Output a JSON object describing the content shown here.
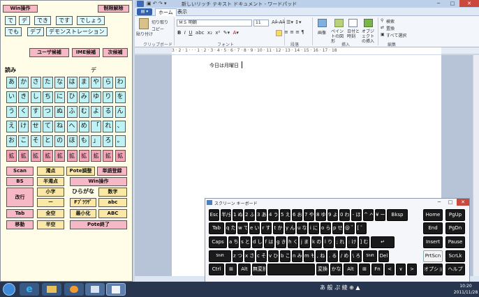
{
  "ime": {
    "top": {
      "win_label": "Win操作",
      "release_label": "制限解除"
    },
    "candidates": [
      [
        "で",
        "デ",
        "でき",
        "です",
        "でしょう"
      ],
      [
        "でも",
        "デブ",
        "デモンストレーション"
      ]
    ],
    "candidate_mode": {
      "user": "ユーザ候補",
      "ime": "IME候補",
      "next": "次候補"
    },
    "reading_label": "読み",
    "reading_value": "デ",
    "kana_rows": [
      [
        "あ",
        "か",
        "さ",
        "た",
        "な",
        "は",
        "ま",
        "や",
        "ら",
        "わ"
      ],
      [
        "い",
        "き",
        "し",
        "ち",
        "に",
        "ひ",
        "み",
        "ゆ",
        "り",
        "を"
      ],
      [
        "う",
        "く",
        "す",
        "つ",
        "ぬ",
        "ふ",
        "む",
        "よ",
        "る",
        "ん"
      ],
      [
        "え",
        "け",
        "せ",
        "て",
        "ね",
        "へ",
        "め",
        "「",
        "れ",
        "、"
      ],
      [
        "お",
        "こ",
        "そ",
        "と",
        "の",
        "ほ",
        "も",
        "」",
        "ろ",
        "。"
      ],
      [
        "拡",
        "拡",
        "拡",
        "拡",
        "拡",
        "拡",
        "拡",
        "拡",
        "拡",
        "拡"
      ]
    ],
    "controls": {
      "scan": "Scan",
      "dakuten": "濁点",
      "pote_adjust": "Pote調整",
      "register": "単語登録",
      "bs": "BS",
      "handakuten": "半濁点",
      "win_op": "Win操作",
      "kaigyo": "改行",
      "small": "小字",
      "hiragana": "ひらがな",
      "number": "数字",
      "dash": "ー",
      "fbrowser": "Fﾌﾞﾗｳｻﾞ",
      "abc_small": "abc",
      "tab": "Tab",
      "zenkaku": "全空",
      "minimize": "最小化",
      "abc_caps": "ABC",
      "move": "移動",
      "hankaku": "半空",
      "pote_end": "Pote終了"
    }
  },
  "wordpad": {
    "title": "新しいリッチ テキスト ドキュメント - ワードパッド",
    "tabs": [
      "ホーム",
      "表示"
    ],
    "ribbon": {
      "clipboard": {
        "paste": "貼り付け",
        "cut": "切り取り",
        "copy": "コピー",
        "label": "クリップボード"
      },
      "font": {
        "name": "ＭＳ 明朝",
        "size": "11",
        "label": "フォント"
      },
      "paragraph": {
        "label": "段落"
      },
      "insert": {
        "image": "画像",
        "paint": "ペイントの図形",
        "datetime": "日付と時刻",
        "object": "オブジェクトの挿入",
        "label": "挿入"
      },
      "edit": {
        "find": "検索",
        "replace": "置換",
        "select_all": "すべて選択",
        "label": "編集"
      }
    },
    "ruler": "3 · 2 · 1 · · · 1 · 2 · 3 · 4 · 5 · 6 · 7 · 8 · 9 · 10 · 11 · 12 · 13 · 14 · 15 · 16 · 17 · 18",
    "doc_text": "今日は月曜日"
  },
  "osk": {
    "title": "スクリーン キーボード",
    "rows": [
      [
        "Esc",
        "半/全",
        "1 ぬ",
        "2 ふ",
        "3 あ",
        "4 う",
        "5 え",
        "6 お",
        "7 や",
        "8 ゆ",
        "9 よ",
        "0 わ",
        "- ほ",
        "^ へ",
        "¥ ー",
        "Bksp",
        "Home",
        "PgUp"
      ],
      [
        "Tab",
        "q た",
        "w て",
        "e い",
        "r す",
        "t か",
        "y ん",
        "u な",
        "i に",
        "o ら",
        "p せ",
        "@ ゛",
        "[ ゜",
        "End",
        "PgDn"
      ],
      [
        "Caps",
        "a ち",
        "s と",
        "d し",
        "f は",
        "g き",
        "h く",
        "j ま",
        "k の",
        "l り",
        "; れ",
        ": け",
        "] む",
        "↵",
        "Insert",
        "Pause"
      ],
      [
        "Shift",
        "z つ",
        "x さ",
        "c そ",
        "v ひ",
        "b こ",
        "n み",
        "m も",
        ", ね",
        ". る",
        "/ め",
        "\\ ろ",
        "Shift",
        "Del",
        "PrtScn",
        "ScrLk"
      ],
      [
        "Ctrl",
        "⊞",
        "Alt",
        "無変換",
        "",
        "変換",
        "かな",
        "Alt",
        "⊞",
        "Fn",
        "<",
        "∨",
        ">",
        "オプション",
        "ヘルプ"
      ]
    ]
  },
  "taskbar": {
    "tray": "あ 般 ぷ 綾 ⊕ ▲",
    "time": "10:20",
    "date": "2011/11/28"
  }
}
